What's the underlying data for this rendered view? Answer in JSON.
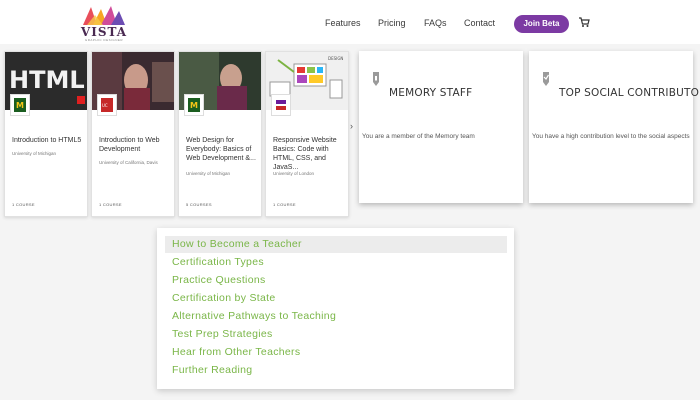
{
  "header": {
    "logo_text": "VISTA",
    "logo_subtext": "GRAPHIC DESIGNER",
    "nav": [
      "Features",
      "Pricing",
      "FAQs",
      "Contact"
    ],
    "join_label": "Join Beta",
    "cart_icon": "cart-icon"
  },
  "courses": [
    {
      "title": "Introduction to HTML5",
      "university": "University of Michigan",
      "count": "1 COURSE"
    },
    {
      "title": "Introduction to Web Development",
      "university": "University of California, Davis",
      "count": "1 COURSE"
    },
    {
      "title": "Web Design for Everybody: Basics of Web Development &...",
      "university": "University of Michigan",
      "count": "5 COURSES"
    },
    {
      "title": "Responsive Website Basics: Code with HTML, CSS, and JavaS...",
      "university": "University of London",
      "count": "1 COURSE"
    }
  ],
  "carousel_next_icon": "chevron-right-icon",
  "badges": [
    {
      "title": "MEMORY STAFF",
      "description": "You are a member of the Memory team",
      "icon": "pen-icon"
    },
    {
      "title": "TOP SOCIAL CONTRIBUTOR",
      "description": "You have a high contribution level to the social aspects",
      "icon": "checkmark-icon"
    }
  ],
  "menu": {
    "items": [
      "How to Become a Teacher",
      "Certification Types",
      "Practice Questions",
      "Certification by State",
      "Alternative Pathways to Teaching",
      "Test Prep Strategies",
      "Hear from Other Teachers",
      "Further Reading"
    ],
    "active_index": 0
  }
}
